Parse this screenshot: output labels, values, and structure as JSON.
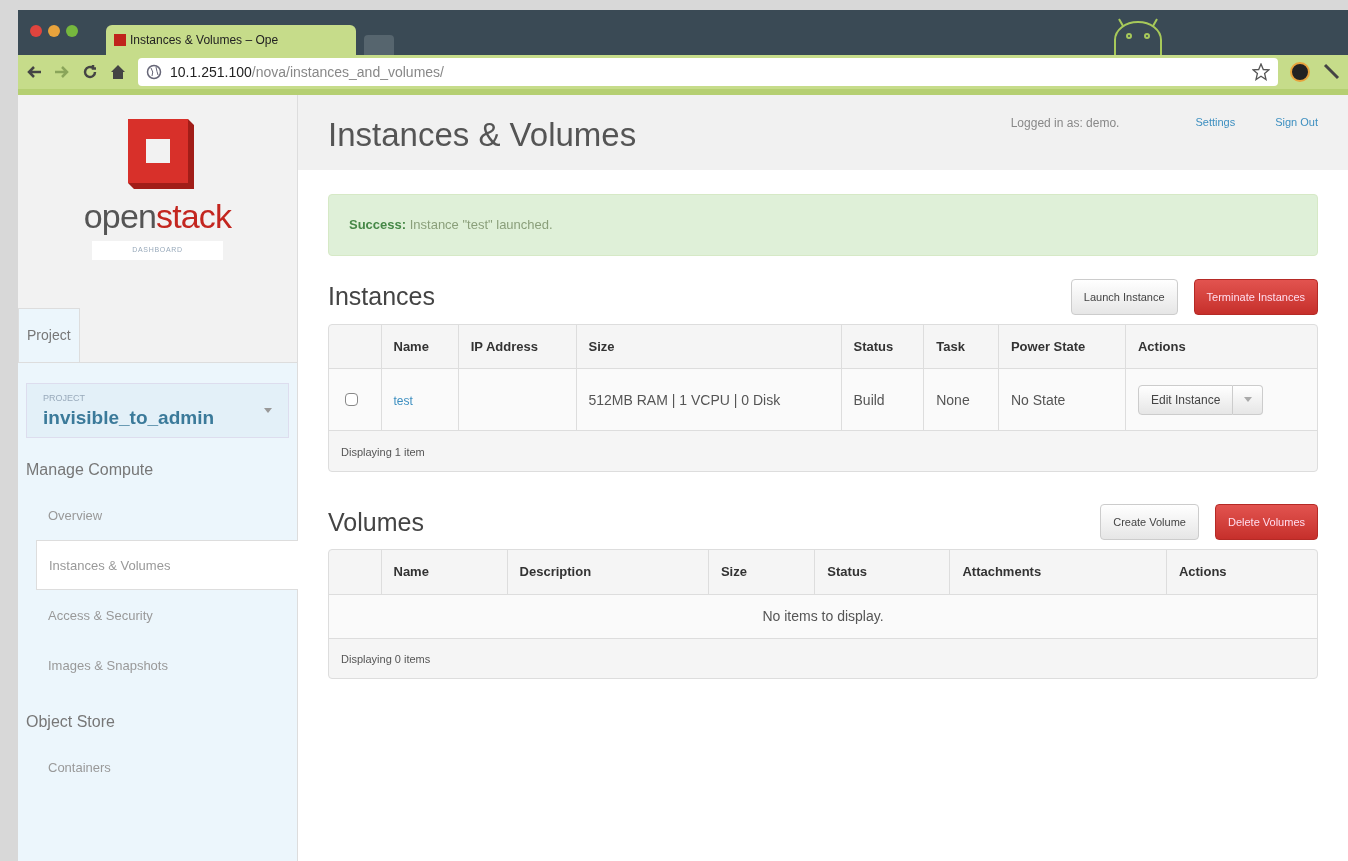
{
  "browser": {
    "tab_title": "Instances & Volumes – Ope",
    "address_host": "10.1.251.100",
    "address_path": "/nova/instances_and_volumes/"
  },
  "sidebar": {
    "logo_word_a": "open",
    "logo_word_b": "stack",
    "logo_sub": "DASHBOARD",
    "tabs": [
      {
        "label": "Project",
        "selected": true
      }
    ],
    "project": {
      "label": "PROJECT",
      "value": "invisible_to_admin"
    },
    "sections": [
      {
        "title": "Manage Compute",
        "items": [
          {
            "label": "Overview",
            "selected": false
          },
          {
            "label": "Instances & Volumes",
            "selected": true
          },
          {
            "label": "Access & Security",
            "selected": false
          },
          {
            "label": "Images & Snapshots",
            "selected": false
          }
        ]
      },
      {
        "title": "Object Store",
        "items": [
          {
            "label": "Containers",
            "selected": false
          }
        ]
      }
    ]
  },
  "header": {
    "title": "Instances & Volumes",
    "logged_in": "Logged in as: demo.",
    "links": [
      "Settings",
      "Sign Out"
    ]
  },
  "alert": {
    "text": "**Success:** Instance \"test\" launched."
  },
  "instances": {
    "title": "Instances",
    "buttons": [
      {
        "label": "Launch Instance",
        "kind": "default"
      },
      {
        "label": "Terminate Instances",
        "kind": "danger"
      }
    ],
    "columns": [
      "Name",
      "IP Address",
      "Size",
      "Status",
      "Task",
      "Power State",
      "Actions"
    ],
    "rows": [
      {
        "checked": false,
        "name": "test",
        "ip": "",
        "size": "512MB RAM | 1 VCPU | 0 Disk",
        "status": "Build",
        "task": "None",
        "power_state": "No State",
        "action": "Edit Instance"
      }
    ],
    "footer": "Displaying 1 item"
  },
  "volumes": {
    "title": "Volumes",
    "buttons": [
      {
        "label": "Create Volume",
        "kind": "default"
      },
      {
        "label": "Delete Volumes",
        "kind": "danger"
      }
    ],
    "columns": [
      "Name",
      "Description",
      "Size",
      "Status",
      "Attachments",
      "Actions"
    ],
    "empty": "No items to display.",
    "footer": "Displaying 0 items"
  }
}
